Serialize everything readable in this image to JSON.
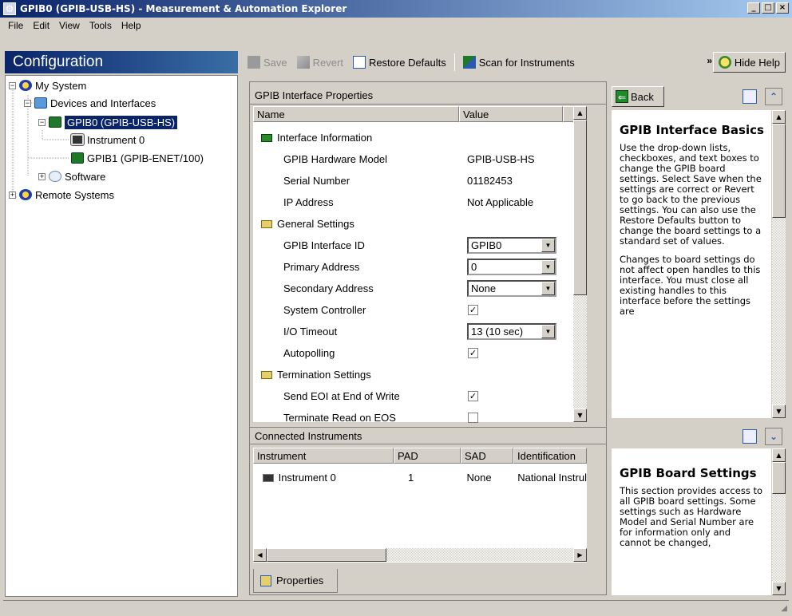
{
  "window": {
    "title": "GPIB0 (GPIB-USB-HS) - Measurement & Automation Explorer",
    "min": "_",
    "max": "□",
    "close": "×"
  },
  "menu": [
    "File",
    "Edit",
    "View",
    "Tools",
    "Help"
  ],
  "config": {
    "header": "Configuration"
  },
  "tree": [
    {
      "label": "My System"
    },
    {
      "label": "Devices and Interfaces"
    },
    {
      "label": "GPIB0 (GPIB-USB-HS)"
    },
    {
      "label": "Instrument 0"
    },
    {
      "label": "GPIB1 (GPIB-ENET/100)"
    },
    {
      "label": "Software"
    },
    {
      "label": "Remote Systems"
    }
  ],
  "toolbar": {
    "save": "Save",
    "revert": "Revert",
    "restore": "Restore Defaults",
    "scan": "Scan for Instruments",
    "more": "»",
    "hide_help": "Hide Help"
  },
  "props": {
    "title": "GPIB Interface Properties",
    "col_name": "Name",
    "col_value": "Value",
    "groups": {
      "info": "Interface Information",
      "general": "General Settings",
      "term": "Termination Settings"
    },
    "rows": {
      "model_label": "GPIB Hardware Model",
      "model_value": "GPIB-USB-HS",
      "serial_label": "Serial Number",
      "serial_value": "01182453",
      "ip_label": "IP Address",
      "ip_value": "Not Applicable",
      "id_label": "GPIB Interface ID",
      "id_value": "GPIB0",
      "pad_label": "Primary Address",
      "pad_value": "0",
      "sad_label": "Secondary Address",
      "sad_value": "None",
      "sysctrl_label": "System Controller",
      "timeout_label": "I/O Timeout",
      "timeout_value": "13 (10 sec)",
      "autopoll_label": "Autopolling",
      "eoi_label": "Send EOI at End of Write",
      "eos_label": "Terminate Read on EOS"
    },
    "check_glyph": "✓"
  },
  "instruments": {
    "title": "Connected Instruments",
    "cols": [
      "Instrument",
      "PAD",
      "SAD",
      "Identification"
    ],
    "rows": [
      {
        "name": "Instrument 0",
        "pad": "1",
        "sad": "None",
        "id": "National Instrul"
      }
    ]
  },
  "tab": {
    "label": "Properties"
  },
  "help": {
    "back": "Back",
    "topic1_title": "GPIB Interface Basics",
    "topic1_p1": "Use the drop-down lists, checkboxes, and text boxes to change the GPIB board settings. Select Save when the settings are correct or Revert to go back to the previous settings. You can also use the Restore Defaults button to change the board settings to a standard set of values.",
    "topic1_p2": "Changes to board settings do not affect open handles to this interface. You must close all existing handles to this interface before the settings are",
    "topic2_title": "GPIB Board Settings",
    "topic2_p1": "This section provides access to all GPIB board settings. Some settings such as Hardware Model and Serial Number are for information only and cannot be changed,"
  },
  "colors": {
    "title_start": "#0a246a",
    "title_end": "#a6caf0",
    "selection": "#0a246a"
  }
}
